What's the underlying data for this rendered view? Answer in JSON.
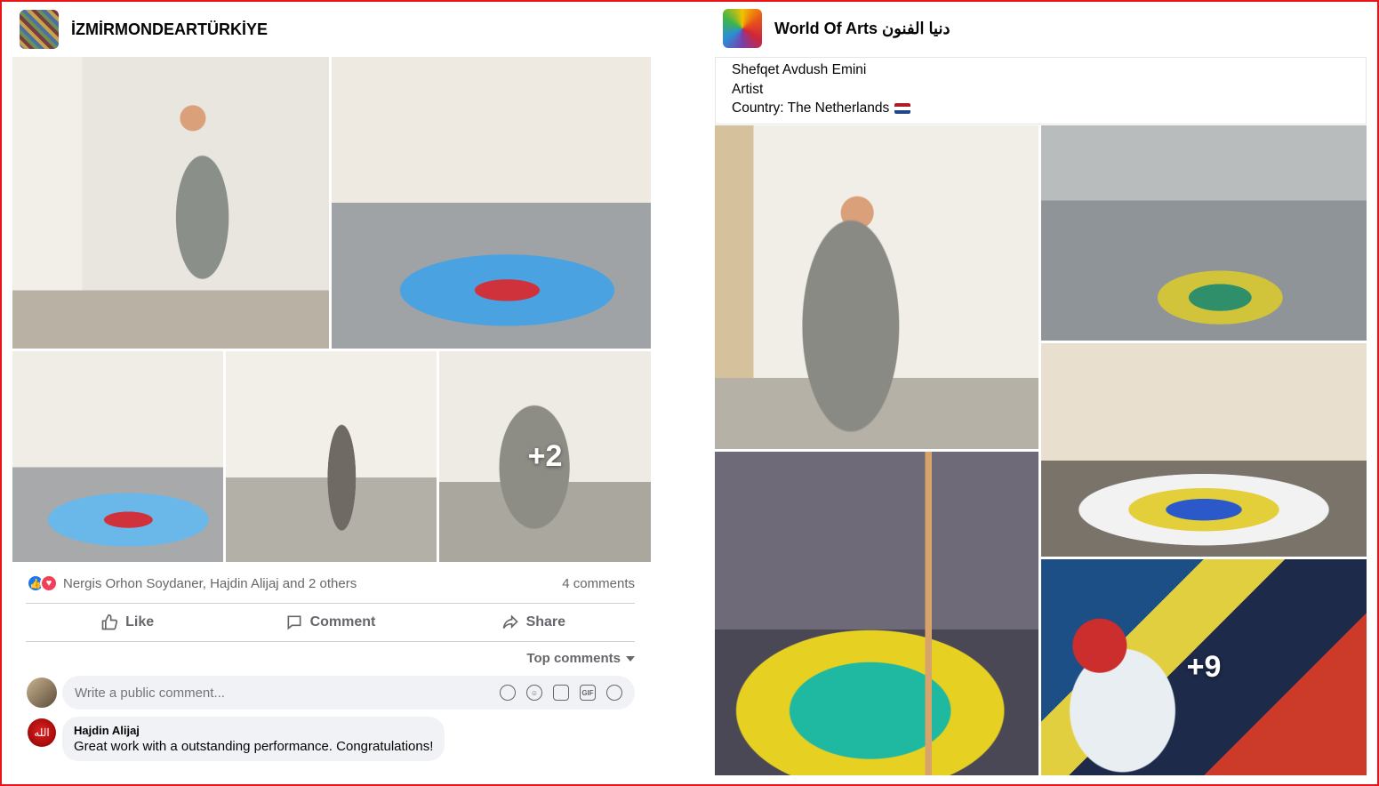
{
  "left_post": {
    "page_name": "İZMİRMONDEARTÜRKİYE",
    "photos": [
      {
        "name": "photo-1",
        "overlay": ""
      },
      {
        "name": "photo-2",
        "overlay": ""
      },
      {
        "name": "photo-3",
        "overlay": ""
      },
      {
        "name": "photo-4",
        "overlay": ""
      },
      {
        "name": "photo-5",
        "overlay": "+2"
      }
    ],
    "reactions_text": "Nergis Orhon Soydaner, Hajdin Alijaj and 2 others",
    "comments_count": "4 comments",
    "actions": {
      "like": "Like",
      "comment": "Comment",
      "share": "Share"
    },
    "top_comments": "Top comments",
    "comment_placeholder": "Write a public comment...",
    "comment": {
      "author": "Hajdin Alijaj",
      "text": "Great work with a outstanding performance. Congratulations!",
      "avatar_glyph": "الله"
    }
  },
  "right_post": {
    "page_name": "World Of Arts دنيا الفنون",
    "intro_lines": [
      "Shefqet Avdush Emini",
      "Artist",
      "Country: The Netherlands"
    ],
    "photos": [
      {
        "name": "photo-1",
        "overlay": ""
      },
      {
        "name": "photo-2",
        "overlay": ""
      },
      {
        "name": "photo-3",
        "overlay": ""
      },
      {
        "name": "photo-4",
        "overlay": ""
      },
      {
        "name": "photo-5",
        "overlay": "+9"
      }
    ]
  },
  "colors": {
    "frame_border": "#e8141a",
    "like_blue": "#1877f2",
    "love_red": "#f33e58",
    "muted_text": "#65676b"
  }
}
